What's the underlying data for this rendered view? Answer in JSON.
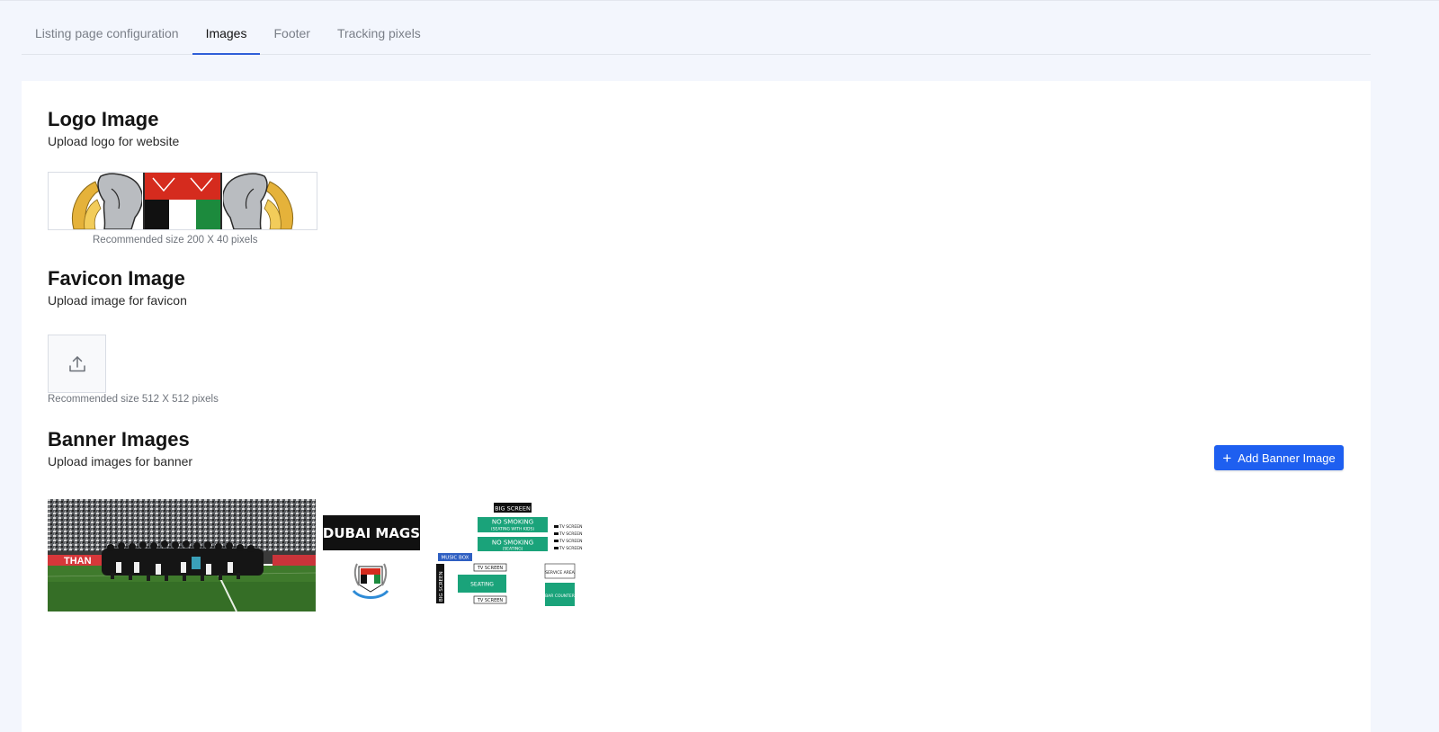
{
  "tabs": [
    {
      "label": "Listing page configuration",
      "active": false
    },
    {
      "label": "Images",
      "active": true
    },
    {
      "label": "Footer",
      "active": false
    },
    {
      "label": "Tracking pixels",
      "active": false
    }
  ],
  "logo": {
    "title": "Logo Image",
    "subtitle": "Upload logo for website",
    "hint": "Recommended size 200 X 40 pixels"
  },
  "favicon": {
    "title": "Favicon Image",
    "subtitle": "Upload image for favicon",
    "hint": "Recommended size 512 X 512 pixels",
    "upload_icon": "upload-icon"
  },
  "banner": {
    "title": "Banner Images",
    "subtitle": "Upload images for banner",
    "add_button_label": "Add Banner Image",
    "add_icon": "plus-icon",
    "images": [
      {
        "kind": "team-photo",
        "text": "THAN"
      },
      {
        "kind": "venue-map",
        "brand_text": "DUBAI MAGS",
        "labels": {
          "big_screen_top": "BIG SCREEN",
          "no_smoking_1": "NO SMOKING",
          "no_smoking_1_sub": "(SEATING WITH KIDS)",
          "no_smoking_2": "NO SMOKING",
          "no_smoking_2_sub": "(SEATING)",
          "music_box": "MUSIC BOX",
          "tv_screen_a": "TV SCREEN",
          "tv_screen_b": "TV SCREEN",
          "seating": "SEATING",
          "big_screen_side": "BIG SCREEN",
          "service_area": "SERVICE AREA",
          "bar_counter": "BAR COUNTER",
          "tv_small": "TV SCREEN"
        }
      }
    ]
  },
  "colors": {
    "accent": "#1e5ff0",
    "tab_underline": "#2f5fd8",
    "venue_green": "#1aa37a"
  }
}
